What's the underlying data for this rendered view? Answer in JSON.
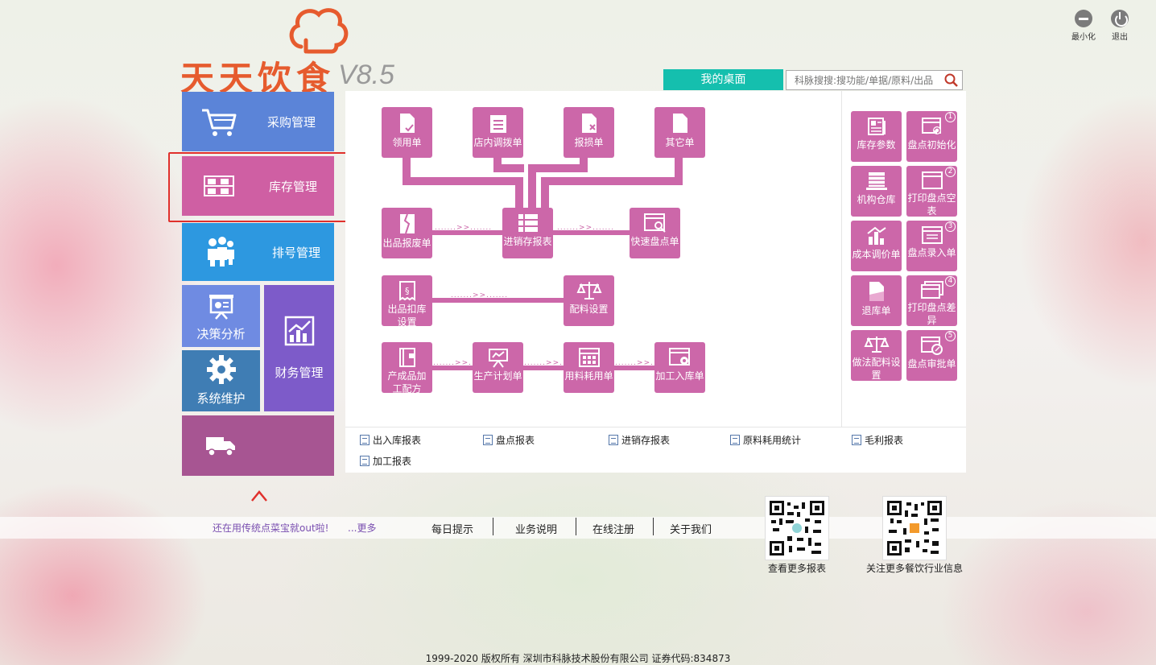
{
  "window": {
    "minimize_label": "最小化",
    "exit_label": "退出"
  },
  "logo": {
    "name": "天天饮食",
    "version": "V8.5"
  },
  "header": {
    "desktop_tab": "我的桌面",
    "search_placeholder": "科脉搜搜:搜功能/单据/原料/出品"
  },
  "menu": {
    "purchase": "采购管理",
    "stock": "库存管理",
    "queue": "排号管理",
    "analysis": "决策分析",
    "finance": "财务管理",
    "system": "系统维护"
  },
  "flow": {
    "requisition": "领用单",
    "transfer": "店内调拨单",
    "loss": "报损单",
    "other": "其它单",
    "product_loss": "出品报废单",
    "inv_report": "进销存报表",
    "quick_count": "快速盘点单",
    "deduct_line1": "出品扣库",
    "deduct_line2": "设置",
    "ingredient_setting": "配料设置",
    "semi_line1": "产成品加",
    "semi_line2": "工配方",
    "production_plan": "生产计划单",
    "material_use": "用料耗用单",
    "process_in": "加工入库单",
    "dots": ".......>>......."
  },
  "right_tiles": {
    "stock_params": "库存参数",
    "count_init": "盘点初始化",
    "org_warehouse": "机构仓库",
    "print_blank_line1": "打印盘点空",
    "print_blank_line2": "表",
    "cost_adjust": "成本调价单",
    "count_entry": "盘点录入单",
    "return": "退库单",
    "print_diff_line1": "打印盘点差",
    "print_diff_line2": "异",
    "recipe_line1": "做法配料设",
    "recipe_line2": "置",
    "count_approve": "盘点审批单",
    "n1": "1",
    "n2": "2",
    "n3": "3",
    "n4": "4",
    "n5": "5"
  },
  "reports": [
    "出入库报表",
    "盘点报表",
    "进销存报表",
    "原料耗用统计",
    "毛利报表",
    "加工报表"
  ],
  "bottom": {
    "tip": "还在用传统点菜宝就out啦!",
    "more": "...更多",
    "links": [
      "每日提示",
      "业务说明",
      "在线注册",
      "关于我们"
    ],
    "qr1_caption": "查看更多报表",
    "qr2_caption": "关注更多餐饮行业信息"
  },
  "footer": "1999-2020  版权所有  深圳市科脉技术股份有限公司  证券代码:834873",
  "colors": {
    "tile": "#cc67a9",
    "accent": "#15bfae",
    "logo": "#e65b2e"
  }
}
